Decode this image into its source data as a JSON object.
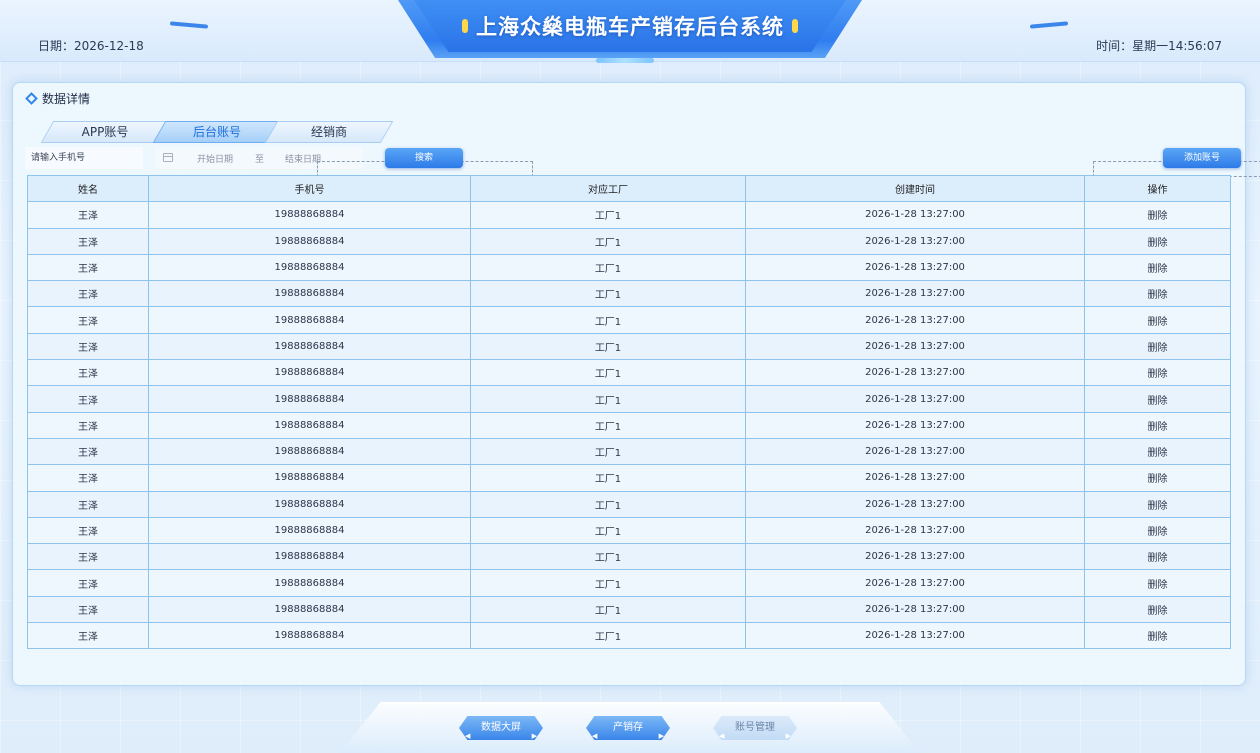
{
  "header": {
    "title": "上海众燊电瓶车产销存后台系统",
    "date_label": "日期：2026-12-18",
    "time_label": "时间：星期一14:56:07"
  },
  "panel": {
    "title": "数据详情",
    "tabs": [
      {
        "label": "APP账号",
        "active": false
      },
      {
        "label": "后台账号",
        "active": true
      },
      {
        "label": "经销商",
        "active": false
      }
    ],
    "phone_placeholder": "请输入手机号",
    "start_date_placeholder": "开始日期",
    "range_sep": "至",
    "end_date_placeholder": "结束日期",
    "search_label": "搜索",
    "add_label": "添加账号"
  },
  "table": {
    "columns": [
      "姓名",
      "手机号",
      "对应工厂",
      "创建时间",
      "操作"
    ],
    "rows": [
      [
        "王泽",
        "19888868884",
        "工厂1",
        "2026-1-28  13:27:00",
        "删除"
      ],
      [
        "王泽",
        "19888868884",
        "工厂1",
        "2026-1-28  13:27:00",
        "删除"
      ],
      [
        "王泽",
        "19888868884",
        "工厂1",
        "2026-1-28  13:27:00",
        "删除"
      ],
      [
        "王泽",
        "19888868884",
        "工厂1",
        "2026-1-28  13:27:00",
        "删除"
      ],
      [
        "王泽",
        "19888868884",
        "工厂1",
        "2026-1-28  13:27:00",
        "删除"
      ],
      [
        "王泽",
        "19888868884",
        "工厂1",
        "2026-1-28  13:27:00",
        "删除"
      ],
      [
        "王泽",
        "19888868884",
        "工厂1",
        "2026-1-28  13:27:00",
        "删除"
      ],
      [
        "王泽",
        "19888868884",
        "工厂1",
        "2026-1-28  13:27:00",
        "删除"
      ],
      [
        "王泽",
        "19888868884",
        "工厂1",
        "2026-1-28  13:27:00",
        "删除"
      ],
      [
        "王泽",
        "19888868884",
        "工厂1",
        "2026-1-28  13:27:00",
        "删除"
      ],
      [
        "王泽",
        "19888868884",
        "工厂1",
        "2026-1-28  13:27:00",
        "删除"
      ],
      [
        "王泽",
        "19888868884",
        "工厂1",
        "2026-1-28  13:27:00",
        "删除"
      ],
      [
        "王泽",
        "19888868884",
        "工厂1",
        "2026-1-28  13:27:00",
        "删除"
      ],
      [
        "王泽",
        "19888868884",
        "工厂1",
        "2026-1-28  13:27:00",
        "删除"
      ],
      [
        "王泽",
        "19888868884",
        "工厂1",
        "2026-1-28  13:27:00",
        "删除"
      ],
      [
        "王泽",
        "19888868884",
        "工厂1",
        "2026-1-28  13:27:00",
        "删除"
      ],
      [
        "王泽",
        "19888868884",
        "工厂1",
        "2026-1-28  13:27:00",
        "删除"
      ]
    ]
  },
  "bottom_nav": [
    {
      "label": "数据大屏",
      "active": true
    },
    {
      "label": "产销存",
      "active": true
    },
    {
      "label": "账号管理",
      "active": false
    }
  ],
  "colors": {
    "accent": "#2f7df0",
    "title_deco": "#ffd84a",
    "table_border": "#8ec3ec"
  },
  "icons": {
    "panel_title_icon": "diamond-icon",
    "date_icon": "calendar-icon",
    "nav_arrows": "chevron-icon"
  }
}
